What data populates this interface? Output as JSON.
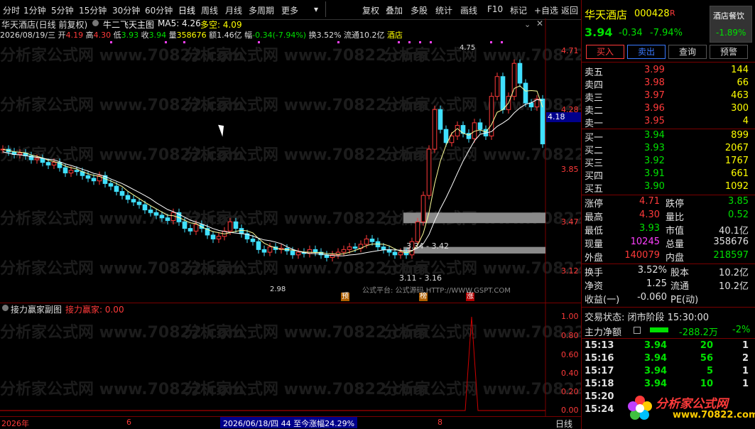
{
  "toolbar": {
    "left_items": [
      "分时",
      "1分钟",
      "5分钟",
      "15分钟",
      "30分钟",
      "60分钟",
      "日线",
      "周线",
      "月线",
      "多周期",
      "更多"
    ],
    "right_items": [
      "复权",
      "叠加",
      "多股",
      "统计",
      "画线",
      "F10",
      "标记",
      "+自选",
      "返回"
    ]
  },
  "header": {
    "stock_title": "华天酒店(日线 前复权)",
    "indicator": "牛二飞天主图",
    "ma5": "MA5: 4.26",
    "duokong": "多空: 4.09",
    "date": "2026/08/19/三",
    "open_label": "开",
    "open": "4.19",
    "high_label": "高",
    "high": "4.30",
    "low_label": "低",
    "low": "3.93",
    "close_label": "收",
    "close": "3.94",
    "vol_label": "量",
    "vol": "358676",
    "amount": "额1.46亿",
    "change_label": "幅",
    "change": "-0.34(-7.94%)",
    "turnover": "换3.52%",
    "float_cap": "流通10.2亿",
    "sector": "酒店"
  },
  "main_chart": {
    "price_labels": [
      "4.71",
      "4.28",
      "3.85",
      "3.47",
      "3.12"
    ],
    "current_price_tag": "4.18",
    "annotations": {
      "peak": "4.75",
      "low": "2.98",
      "band_upper": "3.34 - 3.42",
      "band_lower": "3.11 - 3.16"
    },
    "markers": [
      "预",
      "榜",
      "涨"
    ],
    "footer_text": "公式平台: 公式源码 HTTP://WWW.GSPT.COM",
    "watermark": "分析家公式网 www.70822.com"
  },
  "sub_chart": {
    "title": "接力赢家副图",
    "series_label": "接力赢家: 0.00",
    "y_labels": [
      "1.00",
      "0.80",
      "0.60",
      "0.40",
      "0.20",
      "0.00"
    ]
  },
  "status_bar": {
    "year": "2026年",
    "tick6": "6",
    "range_text": "2026/06/18/四 44 至今涨幅24.29%",
    "tick8": "8",
    "period": "日线"
  },
  "quote": {
    "name": "华天酒店",
    "code": "000428",
    "r_badge": "R",
    "sector_badge": "酒店餐饮",
    "sector_change": "-1.89%",
    "price": "3.94",
    "change": "-0.34",
    "change_pct": "-7.94%",
    "buttons": [
      "买入",
      "卖出",
      "查询",
      "预警"
    ],
    "asks": [
      {
        "label": "卖五",
        "price": "3.99",
        "vol": "144"
      },
      {
        "label": "卖四",
        "price": "3.98",
        "vol": "66"
      },
      {
        "label": "卖三",
        "price": "3.97",
        "vol": "463"
      },
      {
        "label": "卖二",
        "price": "3.96",
        "vol": "300"
      },
      {
        "label": "卖一",
        "price": "3.95",
        "vol": "4"
      }
    ],
    "bids": [
      {
        "label": "买一",
        "price": "3.94",
        "vol": "899"
      },
      {
        "label": "买二",
        "price": "3.93",
        "vol": "2067"
      },
      {
        "label": "买三",
        "price": "3.92",
        "vol": "1767"
      },
      {
        "label": "买四",
        "price": "3.91",
        "vol": "661"
      },
      {
        "label": "买五",
        "price": "3.90",
        "vol": "1092"
      }
    ],
    "stats": [
      {
        "l1": "涨停",
        "v1": "4.71",
        "l2": "跌停",
        "v2": "3.85",
        "c1": "red",
        "c2": "green"
      },
      {
        "l1": "最高",
        "v1": "4.30",
        "l2": "量比",
        "v2": "0.52",
        "c1": "red",
        "c2": "green"
      },
      {
        "l1": "最低",
        "v1": "3.93",
        "l2": "市值",
        "v2": "40.1亿",
        "c1": "green",
        "c2": "white"
      },
      {
        "l1": "现量",
        "v1": "10245",
        "l2": "总量",
        "v2": "358676",
        "c1": "purple",
        "c2": "white"
      },
      {
        "l1": "外盘",
        "v1": "140079",
        "l2": "内盘",
        "v2": "218597",
        "c1": "red",
        "c2": "green"
      }
    ],
    "stats2": [
      {
        "l1": "换手",
        "v1": "3.52%",
        "l2": "股本",
        "v2": "10.2亿"
      },
      {
        "l1": "净资",
        "v1": "1.25",
        "l2": "流通",
        "v2": "10.2亿"
      },
      {
        "l1": "收益(一)",
        "v1": "-0.060",
        "l2": "PE(动)",
        "v2": ""
      }
    ],
    "trade_status": "交易状态: 闭市阶段 15:30:00",
    "main_net_label": "主力净额",
    "main_net_value": "-288.2万",
    "main_net_pct": "-2%",
    "ticks": [
      {
        "time": "15:13",
        "price": "3.94",
        "vol": "20",
        "n": "1"
      },
      {
        "time": "15:16",
        "price": "3.94",
        "vol": "56",
        "n": "2"
      },
      {
        "time": "15:17",
        "price": "3.94",
        "vol": "5",
        "n": "1"
      },
      {
        "time": "15:18",
        "price": "3.94",
        "vol": "10",
        "n": "1"
      },
      {
        "time": "15:20",
        "price": "",
        "vol": "",
        "n": ""
      },
      {
        "time": "15:24",
        "price": "",
        "vol": "",
        "n": ""
      }
    ],
    "logo_text": "分析家公式网",
    "logo_url": "www.70822.com"
  }
}
